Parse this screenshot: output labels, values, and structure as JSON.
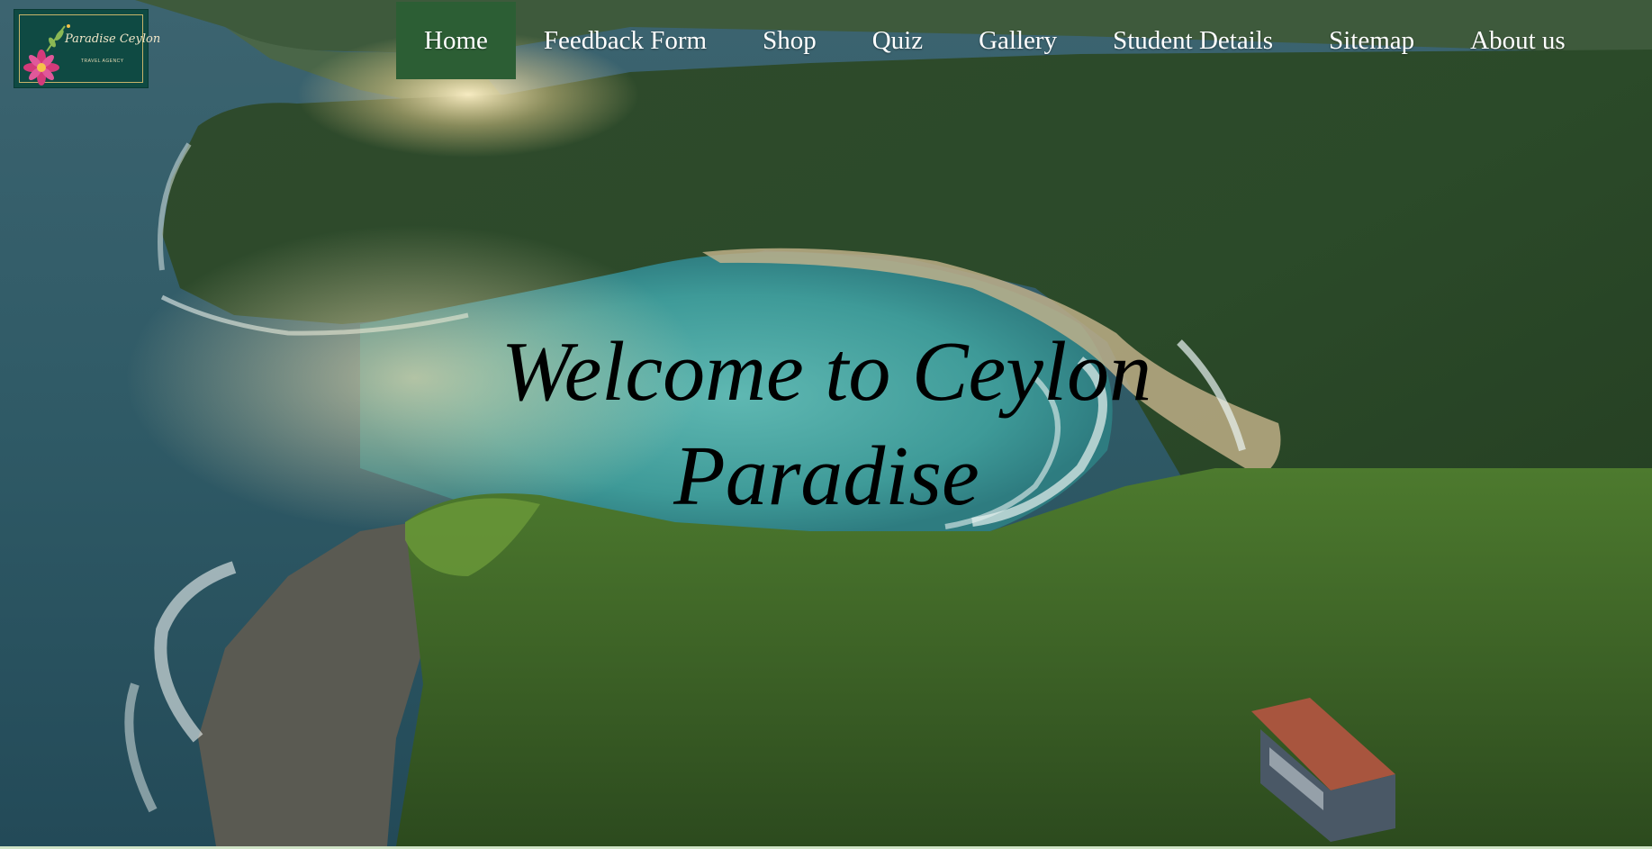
{
  "logo": {
    "brand": "Paradise Ceylon",
    "tagline": "TRAVEL AGENCY",
    "icon": "flower-icon"
  },
  "nav": {
    "items": [
      {
        "label": "Home",
        "active": true
      },
      {
        "label": "Feedback Form"
      },
      {
        "label": "Shop"
      },
      {
        "label": "Quiz"
      },
      {
        "label": "Gallery"
      },
      {
        "label": "Student Details"
      },
      {
        "label": "Sitemap"
      },
      {
        "label": "About us"
      }
    ],
    "active_color": "#2c5e34"
  },
  "hero": {
    "heading": "Welcome to Ceylon Paradise",
    "background": "aerial-bay-coastline-image"
  }
}
